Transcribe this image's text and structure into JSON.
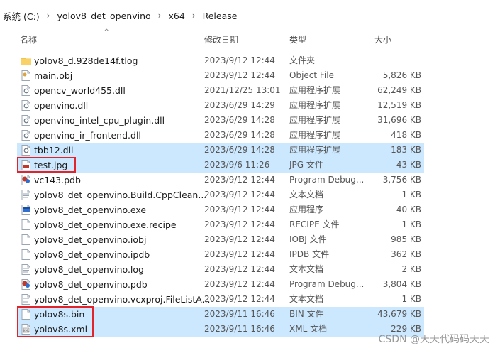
{
  "breadcrumb": [
    "系统 (C:)",
    "yolov8_det_openvino",
    "x64",
    "Release"
  ],
  "columns": {
    "name": "名称",
    "date": "修改日期",
    "type": "类型",
    "size": "大小"
  },
  "files": [
    {
      "name": "yolov8_d.928de14f.tlog",
      "date": "2023/9/12 12:44",
      "type": "文件夹",
      "size": "",
      "icon": "folder-icon",
      "selected": false
    },
    {
      "name": "main.obj",
      "date": "2023/9/12 12:44",
      "type": "Object File",
      "size": "5,826 KB",
      "icon": "obj-file-icon",
      "selected": false
    },
    {
      "name": "opencv_world455.dll",
      "date": "2021/12/25 13:01",
      "type": "应用程序扩展",
      "size": "62,249 KB",
      "icon": "dll-file-icon",
      "selected": false
    },
    {
      "name": "openvino.dll",
      "date": "2023/6/29 14:29",
      "type": "应用程序扩展",
      "size": "12,519 KB",
      "icon": "dll-file-icon",
      "selected": false
    },
    {
      "name": "openvino_intel_cpu_plugin.dll",
      "date": "2023/6/29 14:28",
      "type": "应用程序扩展",
      "size": "31,696 KB",
      "icon": "dll-file-icon",
      "selected": false
    },
    {
      "name": "openvino_ir_frontend.dll",
      "date": "2023/6/29 14:28",
      "type": "应用程序扩展",
      "size": "418 KB",
      "icon": "dll-file-icon",
      "selected": false
    },
    {
      "name": "tbb12.dll",
      "date": "2023/6/29 14:28",
      "type": "应用程序扩展",
      "size": "183 KB",
      "icon": "dll-file-icon",
      "selected": true
    },
    {
      "name": "test.jpg",
      "date": "2023/9/6 11:26",
      "type": "JPG 文件",
      "size": "43 KB",
      "icon": "image-file-icon",
      "selected": true
    },
    {
      "name": "vc143.pdb",
      "date": "2023/9/12 12:44",
      "type": "Program Debug...",
      "size": "3,756 KB",
      "icon": "pdb-file-icon",
      "selected": false
    },
    {
      "name": "yolov8_det_openvino.Build.CppClean...",
      "date": "2023/9/12 12:44",
      "type": "文本文档",
      "size": "1 KB",
      "icon": "text-file-icon",
      "selected": false
    },
    {
      "name": "yolov8_det_openvino.exe",
      "date": "2023/9/12 12:44",
      "type": "应用程序",
      "size": "40 KB",
      "icon": "exe-file-icon",
      "selected": false
    },
    {
      "name": "yolov8_det_openvino.exe.recipe",
      "date": "2023/9/12 12:44",
      "type": "RECIPE 文件",
      "size": "1 KB",
      "icon": "blank-file-icon",
      "selected": false
    },
    {
      "name": "yolov8_det_openvino.iobj",
      "date": "2023/9/12 12:44",
      "type": "IOBJ 文件",
      "size": "985 KB",
      "icon": "blank-file-icon",
      "selected": false
    },
    {
      "name": "yolov8_det_openvino.ipdb",
      "date": "2023/9/12 12:44",
      "type": "IPDB 文件",
      "size": "362 KB",
      "icon": "blank-file-icon",
      "selected": false
    },
    {
      "name": "yolov8_det_openvino.log",
      "date": "2023/9/12 12:44",
      "type": "文本文档",
      "size": "2 KB",
      "icon": "text-file-icon",
      "selected": false
    },
    {
      "name": "yolov8_det_openvino.pdb",
      "date": "2023/9/12 12:44",
      "type": "Program Debug...",
      "size": "3,804 KB",
      "icon": "pdb-file-icon",
      "selected": false
    },
    {
      "name": "yolov8_det_openvino.vcxproj.FileListA...",
      "date": "2023/9/12 12:44",
      "type": "文本文档",
      "size": "1 KB",
      "icon": "text-file-icon",
      "selected": false
    },
    {
      "name": "yolov8s.bin",
      "date": "2023/9/11 16:46",
      "type": "BIN 文件",
      "size": "43,679 KB",
      "icon": "blank-file-icon",
      "selected": true
    },
    {
      "name": "yolov8s.xml",
      "date": "2023/9/11 16:46",
      "type": "XML 文档",
      "size": "229 KB",
      "icon": "xml-file-icon",
      "selected": true
    }
  ],
  "watermark": "CSDN @天天代码码天天",
  "colors": {
    "selection": "#cce8ff",
    "highlight_box": "#e0242a",
    "folder": "#f3c44a"
  }
}
